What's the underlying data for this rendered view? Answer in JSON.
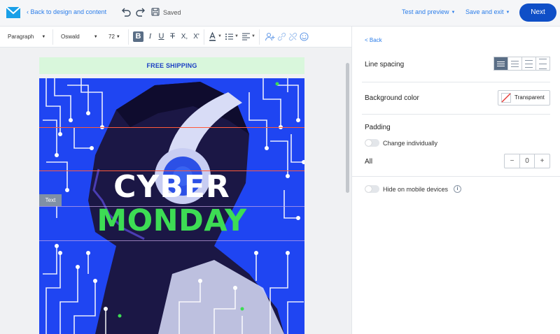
{
  "header": {
    "back_label": "Back to design and content",
    "saved_label": "Saved",
    "test_label": "Test and preview",
    "save_exit_label": "Save and exit",
    "next_label": "Next",
    "accent": "#0f4fc7"
  },
  "toolbar": {
    "paragraph_style": "Paragraph",
    "font_family": "Oswald",
    "font_size": "72",
    "bold_glyph": "B",
    "italic_glyph": "I",
    "underline_glyph": "U",
    "strike_glyph": "T",
    "subscript_glyph": "X,",
    "superscript_glyph": "X'",
    "icons": [
      "bold-icon",
      "italic-icon",
      "underline-icon",
      "strikethrough-icon",
      "subscript-icon",
      "superscript-icon",
      "text-color-icon",
      "list-icon",
      "align-icon",
      "personalize-icon",
      "link-icon",
      "unlink-icon",
      "emoji-icon"
    ]
  },
  "email": {
    "shipping_text": "FREE SHIPPING",
    "headline_1": "CYBER",
    "headline_2": "MONDAY",
    "text_tag": "Text",
    "colors": {
      "background": "#1e44f0",
      "shipping_bg": "#d9f7dc",
      "headline_2": "#3ddc54"
    }
  },
  "panel": {
    "back_label": "< Back",
    "line_spacing_label": "Line spacing",
    "line_spacing_selected": 1,
    "background_label": "Background color",
    "background_value": "Transparent",
    "padding_label": "Padding",
    "change_individually_label": "Change individually",
    "change_individually_on": false,
    "all_label": "All",
    "padding_value": "0",
    "minus": "−",
    "plus": "+",
    "hide_mobile_label": "Hide on mobile devices",
    "hide_mobile_on": false,
    "info_glyph": "i"
  }
}
